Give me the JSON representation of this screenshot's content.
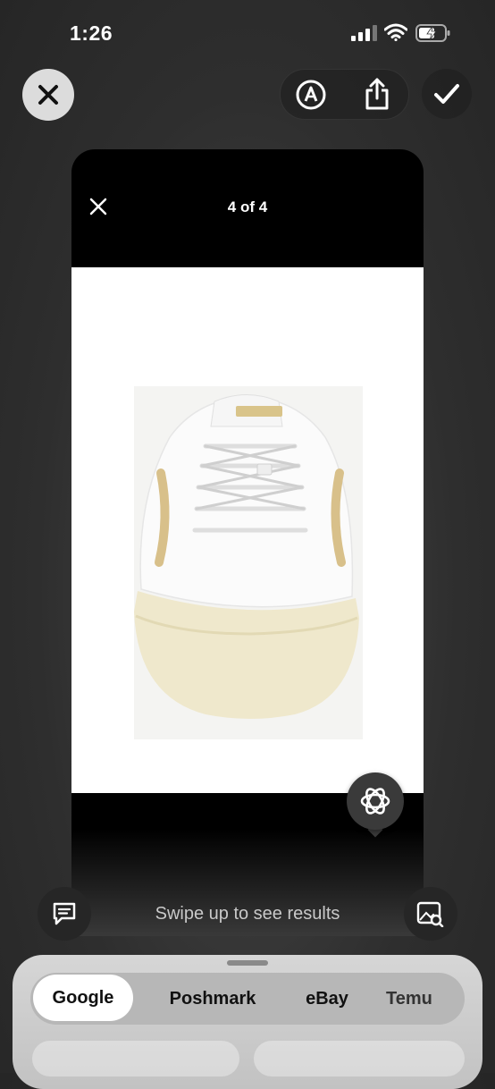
{
  "status_bar": {
    "time": "1:26"
  },
  "top_bar": {
    "close": "close-icon",
    "markup": "markup-icon",
    "share": "share-icon",
    "done": "checkmark-icon"
  },
  "viewer": {
    "counter": "4 of 4",
    "close": "close-icon"
  },
  "bottom": {
    "hint": "Swipe up to see results"
  },
  "sheet": {
    "tabs": [
      {
        "label": "Google",
        "active": true
      },
      {
        "label": "Poshmark",
        "active": false
      },
      {
        "label": "eBay",
        "active": false
      },
      {
        "label": "Temu",
        "active": false
      }
    ]
  }
}
